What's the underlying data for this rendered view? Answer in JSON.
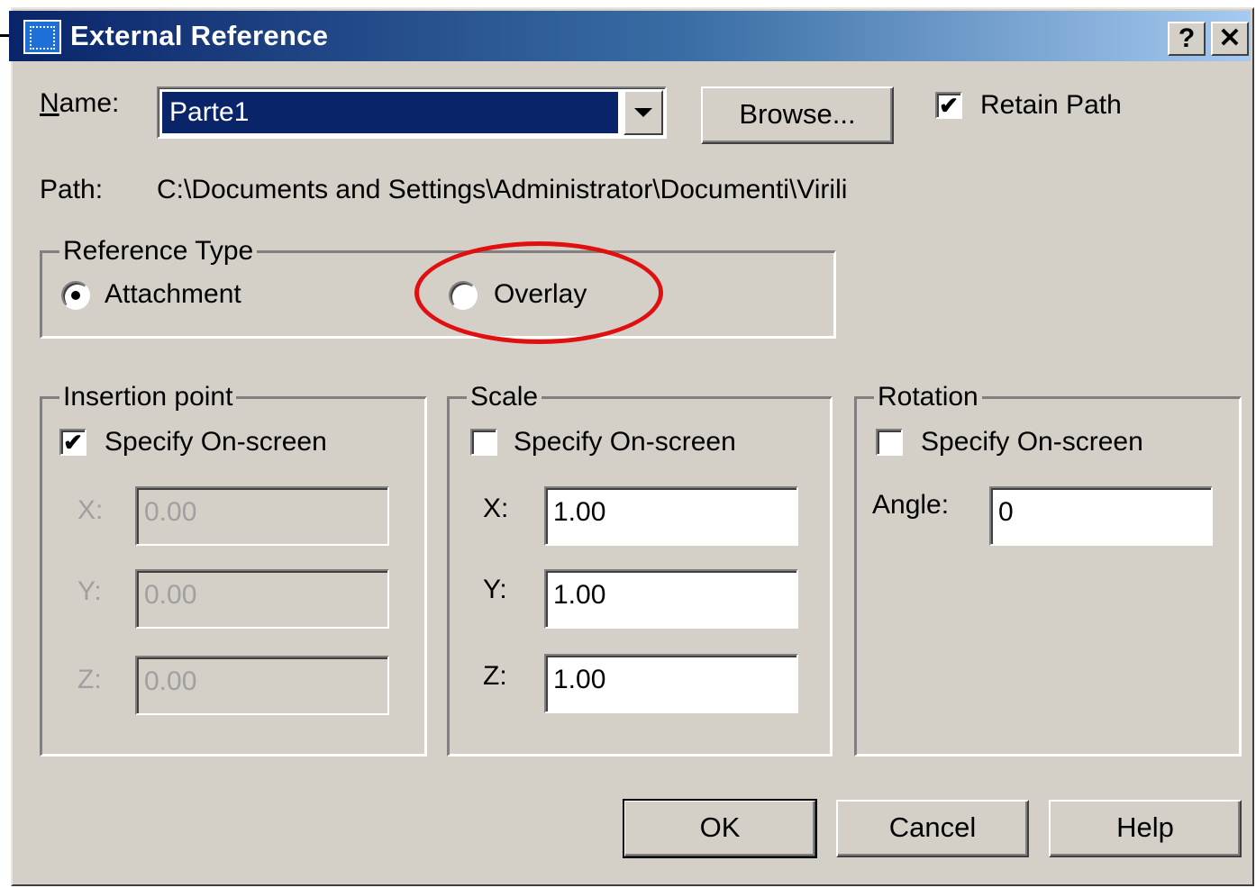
{
  "window": {
    "title": "External Reference",
    "help_button": "?",
    "close_button": "✕"
  },
  "name": {
    "label": "Name:",
    "value": "Parte1",
    "browse": "Browse...",
    "retain_path": "Retain Path",
    "retain_path_checked": true
  },
  "path": {
    "label": "Path:",
    "value": "C:\\Documents and Settings\\Administrator\\Documenti\\Virili"
  },
  "reference_type": {
    "caption": "Reference Type",
    "attachment": "Attachment",
    "overlay": "Overlay",
    "selected": "Attachment"
  },
  "insertion_point": {
    "caption": "Insertion point",
    "specify": "Specify On-screen",
    "specify_checked": true,
    "x_label": "X:",
    "y_label": "Y:",
    "z_label": "Z:",
    "x": "0.00",
    "y": "0.00",
    "z": "0.00"
  },
  "scale": {
    "caption": "Scale",
    "specify": "Specify On-screen",
    "specify_checked": false,
    "x_label": "X:",
    "y_label": "Y:",
    "z_label": "Z:",
    "x": "1.00",
    "y": "1.00",
    "z": "1.00"
  },
  "rotation": {
    "caption": "Rotation",
    "specify": "Specify On-screen",
    "specify_checked": false,
    "angle_label": "Angle:",
    "angle": "0"
  },
  "buttons": {
    "ok": "OK",
    "cancel": "Cancel",
    "help": "Help"
  },
  "colors": {
    "dialog_bg": "#d4d0c8",
    "title_start": "#0a246a",
    "title_end": "#a6caf0",
    "selection": "#0a246a",
    "annotation": "#e01010"
  }
}
